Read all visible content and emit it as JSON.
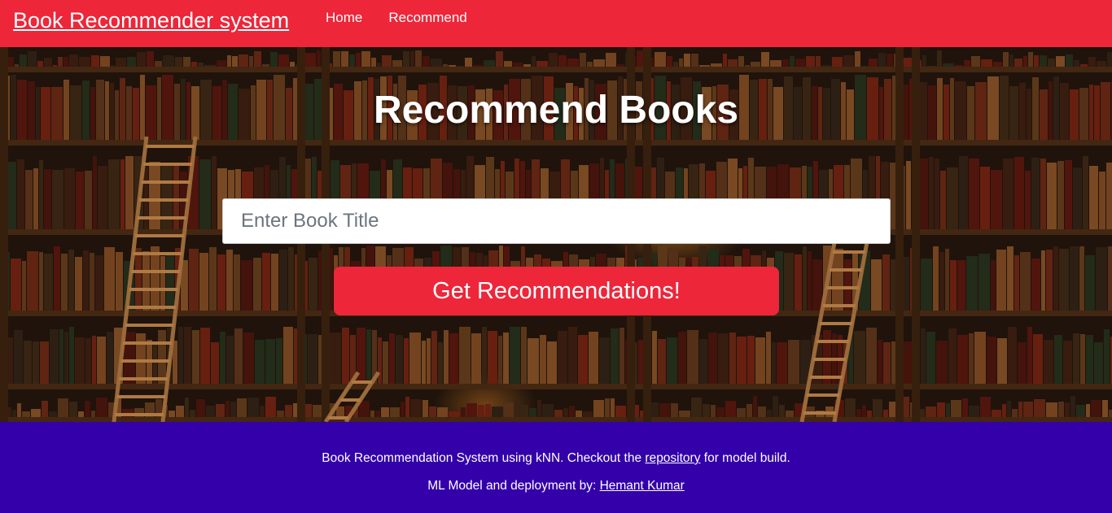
{
  "navbar": {
    "brand": "Book Recommender system",
    "links": [
      {
        "label": "Home"
      },
      {
        "label": "Recommend"
      }
    ],
    "color": "#ed263a"
  },
  "hero": {
    "title": "Recommend Books",
    "search": {
      "placeholder": "Enter Book Title",
      "value": ""
    },
    "button_label": "Get Recommendations!",
    "background": "bookshelf-library-image"
  },
  "footer": {
    "line1_prefix": "Book Recommendation System using kNN. Checkout the ",
    "line1_link": "repository",
    "line1_suffix": " for model build.",
    "line2_prefix": "ML Model and deployment by: ",
    "line2_link": "Hemant Kumar",
    "color": "#3300aa"
  }
}
